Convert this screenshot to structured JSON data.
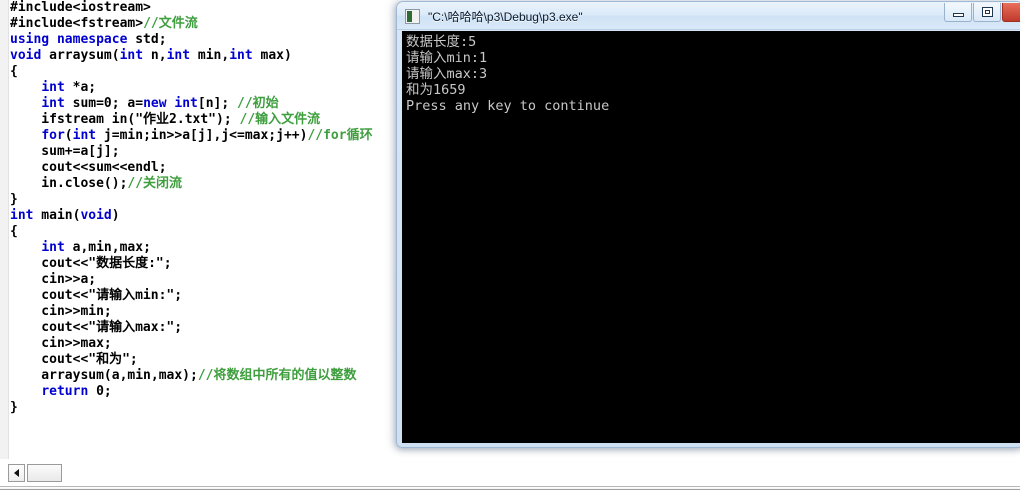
{
  "editor": {
    "name": "code-editor",
    "code_lines": [
      [
        {
          "t": "#include<iostream>",
          "c": "pp"
        }
      ],
      [
        {
          "t": "#include<fstream>",
          "c": "pp"
        },
        {
          "t": "//文件流",
          "c": "cm"
        }
      ],
      [
        {
          "t": "using namespace",
          "c": "kw"
        },
        {
          "t": " std;",
          "c": "pl"
        }
      ],
      [
        {
          "t": "void",
          "c": "kw"
        },
        {
          "t": " arraysum(",
          "c": "pl"
        },
        {
          "t": "int",
          "c": "kw"
        },
        {
          "t": " n,",
          "c": "pl"
        },
        {
          "t": "int",
          "c": "kw"
        },
        {
          "t": " min,",
          "c": "pl"
        },
        {
          "t": "int",
          "c": "kw"
        },
        {
          "t": " max)",
          "c": "pl"
        }
      ],
      [
        {
          "t": "{",
          "c": "pl"
        }
      ],
      [
        {
          "t": "    ",
          "c": "pl"
        },
        {
          "t": "int",
          "c": "kw"
        },
        {
          "t": " *a;",
          "c": "pl"
        }
      ],
      [
        {
          "t": "    ",
          "c": "pl"
        },
        {
          "t": "int",
          "c": "kw"
        },
        {
          "t": " sum=0; a=",
          "c": "pl"
        },
        {
          "t": "new",
          "c": "kw"
        },
        {
          "t": " ",
          "c": "pl"
        },
        {
          "t": "int",
          "c": "kw"
        },
        {
          "t": "[n]; ",
          "c": "pl"
        },
        {
          "t": "//初始",
          "c": "cm"
        }
      ],
      [
        {
          "t": "    ifstream in(\"作业2.txt\"); ",
          "c": "pl"
        },
        {
          "t": "//输入文件流",
          "c": "cm"
        }
      ],
      [
        {
          "t": "    ",
          "c": "pl"
        },
        {
          "t": "for",
          "c": "kw"
        },
        {
          "t": "(",
          "c": "pl"
        },
        {
          "t": "int",
          "c": "kw"
        },
        {
          "t": " j=min;in>>a[j],j<=max;j++)",
          "c": "pl"
        },
        {
          "t": "//for循环",
          "c": "cm"
        }
      ],
      [
        {
          "t": "    sum+=a[j];",
          "c": "pl"
        }
      ],
      [
        {
          "t": "    cout<<sum<<endl;",
          "c": "pl"
        }
      ],
      [
        {
          "t": "    in.close();",
          "c": "pl"
        },
        {
          "t": "//关闭流",
          "c": "cm"
        }
      ],
      [
        {
          "t": "}",
          "c": "pl"
        }
      ],
      [
        {
          "t": "int",
          "c": "kw"
        },
        {
          "t": " main(",
          "c": "pl"
        },
        {
          "t": "void",
          "c": "kw"
        },
        {
          "t": ")",
          "c": "pl"
        }
      ],
      [
        {
          "t": "{",
          "c": "pl"
        }
      ],
      [
        {
          "t": "    ",
          "c": "pl"
        },
        {
          "t": "int",
          "c": "kw"
        },
        {
          "t": " a,min,max;",
          "c": "pl"
        }
      ],
      [
        {
          "t": "    cout<<\"数据长度:\";",
          "c": "pl"
        }
      ],
      [
        {
          "t": "    cin>>a;",
          "c": "pl"
        }
      ],
      [
        {
          "t": "    cout<<\"请输入min:\";",
          "c": "pl"
        }
      ],
      [
        {
          "t": "    cin>>min;",
          "c": "pl"
        }
      ],
      [
        {
          "t": "    cout<<\"请输入max:\";",
          "c": "pl"
        }
      ],
      [
        {
          "t": "    cin>>max;",
          "c": "pl"
        }
      ],
      [
        {
          "t": "    cout<<\"和为\";",
          "c": "pl"
        }
      ],
      [
        {
          "t": "    arraysum(a,min,max);",
          "c": "pl"
        },
        {
          "t": "//将数组中所有的值以整数",
          "c": "cm"
        }
      ],
      [
        {
          "t": "    ",
          "c": "pl"
        },
        {
          "t": "return",
          "c": "kw"
        },
        {
          "t": " 0;",
          "c": "pl"
        }
      ],
      [
        {
          "t": "}",
          "c": "pl"
        }
      ]
    ],
    "scrollbar": {
      "left_arrow_icon": "triangle-left-icon",
      "thumb_label": ""
    }
  },
  "console": {
    "title": "\"C:\\哈哈哈\\p3\\Debug\\p3.exe\"",
    "app_icon": "console-app-icon",
    "buttons": {
      "minimize": "minimize-icon",
      "maximize": "maximize-icon",
      "close": "close-icon"
    },
    "output_lines": [
      "数据长度:5",
      "请输入min:1",
      "请输入max:3",
      "和为1659",
      "Press any key to continue"
    ]
  },
  "colors": {
    "keyword": "#0000d0",
    "comment": "#3f9f3f",
    "console_bg": "#000000",
    "console_fg": "#c8c8c8",
    "window_frame": "#cfe0f3",
    "close_button": "#c0392b"
  }
}
